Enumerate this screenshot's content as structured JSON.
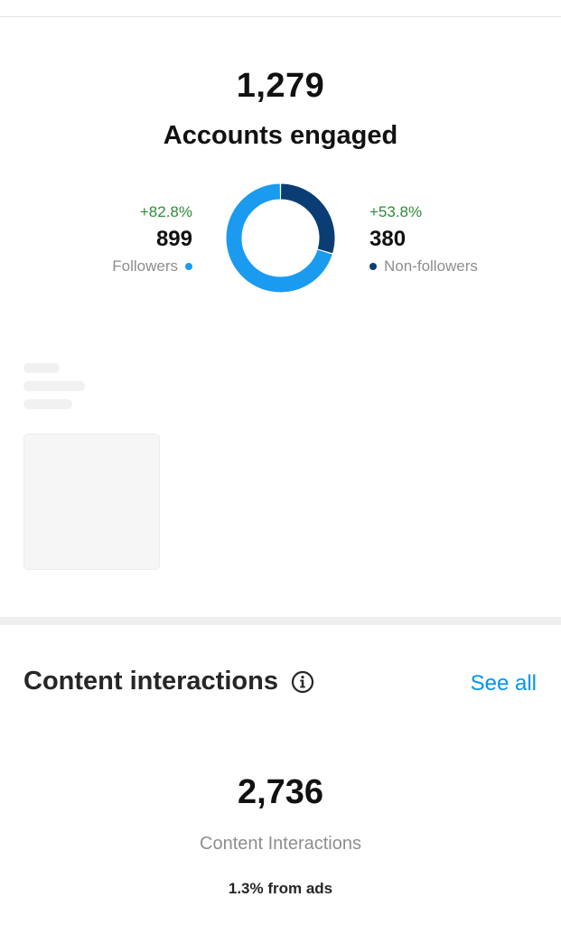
{
  "accounts_engaged": {
    "total": "1,279",
    "title": "Accounts engaged",
    "followers": {
      "change": "+82.8%",
      "value": "899",
      "label": "Followers",
      "count": 899,
      "color": "#1a9bf0"
    },
    "non_followers": {
      "change": "+53.8%",
      "value": "380",
      "label": "Non-followers",
      "count": 380,
      "color": "#0b3d75"
    }
  },
  "content_interactions": {
    "title": "Content interactions",
    "info_icon": "info-icon",
    "see_all_label": "See all",
    "total": "2,736",
    "label": "Content Interactions",
    "ads_note": "1.3% from ads"
  },
  "colors": {
    "accent": "#0095f6",
    "positive_change": "#2e8b3a",
    "muted_text": "#8e8e8e"
  }
}
